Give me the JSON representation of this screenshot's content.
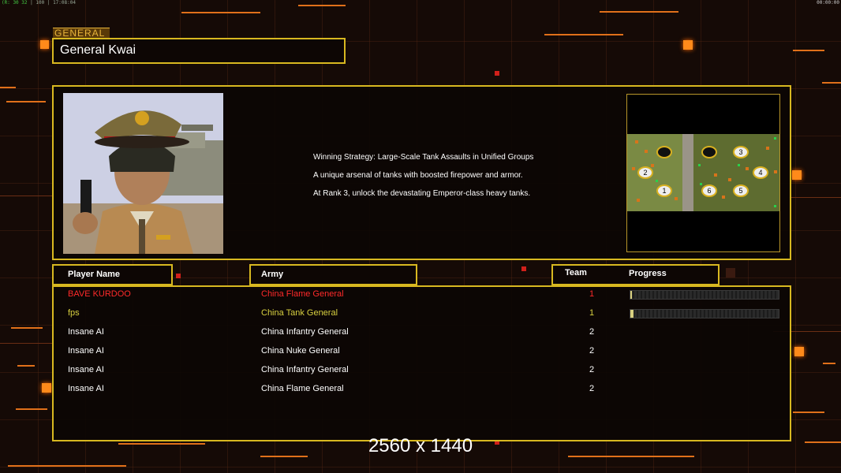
{
  "topbar": {
    "left_prefix": "(R: 30 32",
    "left_counts": "| 100 |",
    "left_time": "17:08:04",
    "right_time": "00:00:00"
  },
  "general": {
    "section_label": "GENERAL",
    "name": "General Kwai"
  },
  "description": {
    "lines": [
      "Winning Strategy: Large-Scale Tank Assaults in Unified Groups",
      "A unique arsenal of tanks with boosted firepower and armor.",
      "At Rank 3, unlock the devastating Emperor-class heavy tanks."
    ]
  },
  "map_preview": {
    "start_positions": [
      "1",
      "2",
      "3",
      "4",
      "5",
      "6"
    ]
  },
  "table_headers": {
    "player_name": "Player Name",
    "army": "Army",
    "team": "Team",
    "progress": "Progress"
  },
  "players": [
    {
      "name": "BAVE KURDOO",
      "army": "China Flame General",
      "team": "1",
      "color": "#ff2a2a",
      "progress": 0.01,
      "show_progress": true
    },
    {
      "name": "fps",
      "army": "China Tank General",
      "team": "1",
      "color": "#d8d040",
      "progress": 0.02,
      "show_progress": true
    },
    {
      "name": "Insane AI",
      "army": "China Infantry General",
      "team": "2",
      "color": "#ffffff",
      "show_progress": false
    },
    {
      "name": "Insane AI",
      "army": "China Nuke General",
      "team": "2",
      "color": "#ffffff",
      "show_progress": false
    },
    {
      "name": "Insane AI",
      "army": "China Infantry General",
      "team": "2",
      "color": "#ffffff",
      "show_progress": false
    },
    {
      "name": "Insane AI",
      "army": "China Flame General",
      "team": "2",
      "color": "#ffffff",
      "show_progress": false
    }
  ],
  "colors": {
    "frame": "#d8b820",
    "accent": "#ff8a1a",
    "background": "#150a06"
  },
  "overlay_text": "2560 x 1440"
}
